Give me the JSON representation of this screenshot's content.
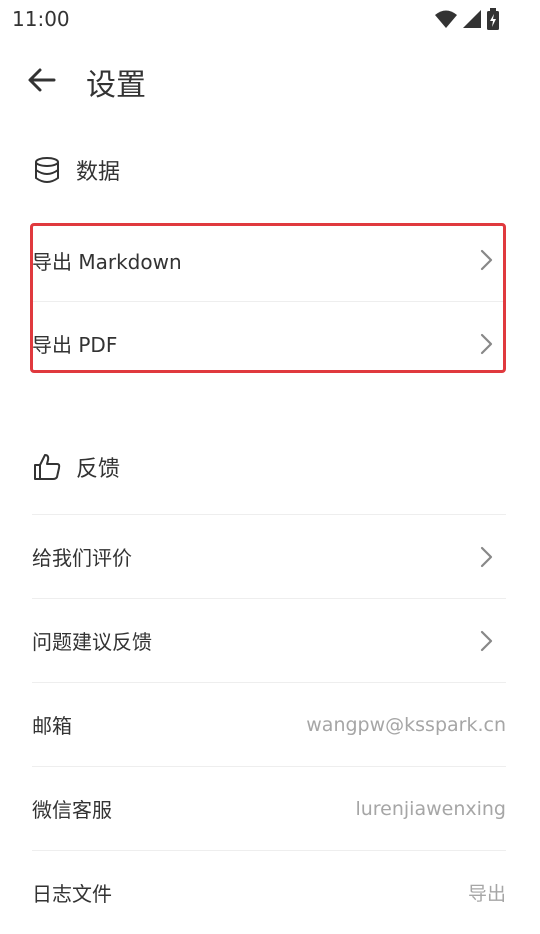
{
  "status_bar": {
    "time": "11:00",
    "icons": [
      "wifi-icon",
      "signal-icon",
      "battery-charging-icon"
    ]
  },
  "header": {
    "back_icon": "arrow-left-icon",
    "title": "设置"
  },
  "sections": {
    "data": {
      "icon": "database-icon",
      "label": "数据",
      "items": [
        {
          "label": "导出 Markdown",
          "icon": "chevron-right-icon"
        },
        {
          "label": "导出 PDF",
          "icon": "chevron-right-icon"
        }
      ]
    },
    "feedback": {
      "icon": "thumbs-up-icon",
      "label": "反馈",
      "items": [
        {
          "label": "给我们评价",
          "icon": "chevron-right-icon"
        },
        {
          "label": "问题建议反馈",
          "icon": "chevron-right-icon"
        },
        {
          "label": "邮箱",
          "value": "wangpw@ksspark.cn"
        },
        {
          "label": "微信客服",
          "value": "lurenjiawenxing"
        },
        {
          "label": "日志文件",
          "value": "导出"
        }
      ]
    }
  },
  "colors": {
    "text": "#333333",
    "muted": "#a6a6a6",
    "divider": "#eeeeee",
    "highlight": "#e0393e"
  }
}
